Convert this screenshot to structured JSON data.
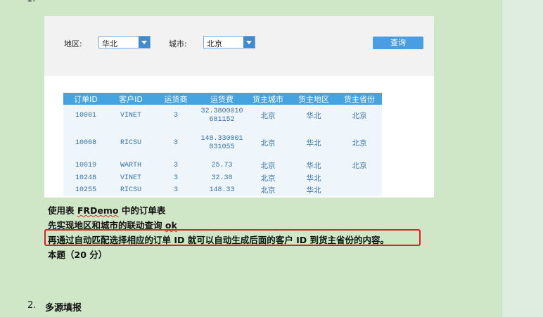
{
  "report": {
    "filters": {
      "region_label": "地区:",
      "region_value": "华北",
      "city_label": "城市:",
      "city_value": "北京",
      "query_button": "查询"
    },
    "table": {
      "headers": [
        "订单ID",
        "客户ID",
        "运货商",
        "运货费",
        "货主城市",
        "货主地区",
        "货主省份"
      ],
      "rows": [
        [
          "10001",
          "VINET",
          "3",
          "32.3800010\n681152",
          "北京",
          "华北",
          "北京"
        ],
        [
          "10008",
          "RICSU",
          "3",
          "148.330001\n831055",
          "北京",
          "华北",
          "北京"
        ],
        [
          "10019",
          "WARTH",
          "3",
          "25.73",
          "北京",
          "华北",
          "北京"
        ],
        [
          "10248",
          "VINET",
          "3",
          "32.38",
          "北京",
          "华北",
          ""
        ],
        [
          "10255",
          "RICSU",
          "3",
          "148.33",
          "北京",
          "华北",
          ""
        ]
      ]
    }
  },
  "text": {
    "line1_prefix": "使用表 ",
    "line1_name": "FRDemo",
    "line1_suffix": " 中的订单表",
    "line2_main": "先实现地区和城市的联动查询 ",
    "line2_ok": "ok",
    "line3": "再通过自动匹配选择相应的订单 ID 就可以自动生成后面的客户 ID 到货主省份的内容。",
    "line4": "本题（20 分）"
  },
  "list": {
    "item2_number": "2.",
    "item2_title": "多源填报"
  },
  "colors": {
    "page_bg": "#cfe6c7",
    "table_header": "#45a3e0",
    "highlight_border": "#e02020"
  }
}
